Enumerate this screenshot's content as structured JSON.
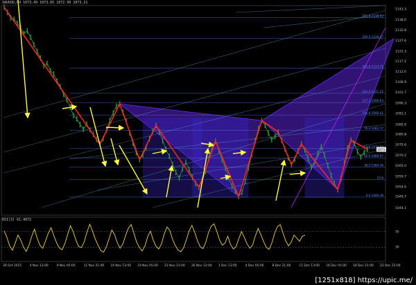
{
  "header": {
    "symbol_line": "XAUUSD,H4  1073.49  1073.65  1072.99  1073.21"
  },
  "rsi_label": "RSI(3) 61.4072",
  "watermark": "[1251x818] https://upic.me/",
  "colors": {
    "background": "#000000",
    "candle": "#2e9c3a",
    "zigzag": "#ff2020",
    "arrow": "#ffff3a",
    "harmonic_fill": "#6a2aff",
    "fib_text": "#5b8fff",
    "trend": "#5fa8d8",
    "rsi": "#f2d33a",
    "axis_text": "#c8c8c8"
  },
  "chart_data": {
    "type": "line",
    "x_ticks": [
      "30 Oct 2015",
      "4 Nov 13:00",
      "9 Nov 05:00",
      "11 Nov 21:00",
      "16 Nov 13:00",
      "19 Nov 05:00",
      "23 Nov 21:00",
      "26 Nov 13:00",
      "1 Dec 13:00",
      "4 Dec 05:00",
      "8 Dec 21:00",
      "11 Dec 13:00",
      "16 Dec 05:00",
      "18 Dec 21:00",
      "23 Dec 13:00"
    ],
    "y_ticks": [
      1044.1,
      1049.7,
      1054.6,
      1059.7,
      1065.0,
      1070.2,
      1075.6,
      1080.8,
      1085.6,
      1091.1,
      1096.3,
      1101.7,
      1106.9,
      1112.0,
      1117.2,
      1122.3,
      1127.6,
      1132.8,
      1138.0,
      1143.3
    ],
    "ylim": [
      1040.4,
      1145.0
    ],
    "price_series": [
      1144.2,
      1141.5,
      1138.8,
      1138.2,
      1136.1,
      1133.8,
      1131.0,
      1132.4,
      1129.2,
      1125.5,
      1122.1,
      1118.7,
      1114.9,
      1116.2,
      1112.5,
      1110.8,
      1107.3,
      1104.5,
      1100.6,
      1097.9,
      1094.2,
      1090.1,
      1088.4,
      1085.6,
      1083.2,
      1085.9,
      1083.0,
      1080.7,
      1078.2,
      1075.8,
      1078.5,
      1082.9,
      1087.6,
      1091.3,
      1094.8,
      1095.9,
      1091.7,
      1087.2,
      1081.5,
      1076.3,
      1071.6,
      1068.1,
      1070.4,
      1074.2,
      1078.6,
      1082.3,
      1085.1,
      1081.8,
      1077.5,
      1073.2,
      1069.8,
      1065.7,
      1061.8,
      1058.9,
      1063.5,
      1066.8,
      1063.0,
      1059.2,
      1056.1,
      1054.2,
      1057.6,
      1062.3,
      1068.9,
      1074.5,
      1077.3,
      1072.6,
      1068.0,
      1063.8,
      1059.0,
      1054.9,
      1052.3,
      1049.7,
      1051.8,
      1057.3,
      1063.9,
      1070.8,
      1077.6,
      1083.5,
      1087.6,
      1085.2,
      1081.3,
      1078.0,
      1079.6,
      1081.9,
      1077.8,
      1073.4,
      1069.0,
      1065.5,
      1068.3,
      1072.5,
      1075.9,
      1073.0,
      1068.6,
      1064.3,
      1066.9,
      1071.2,
      1074.6,
      1070.3,
      1065.1,
      1060.2,
      1056.0,
      1053.1,
      1058.6,
      1066.3,
      1073.8,
      1077.9,
      1076.2,
      1072.1,
      1069.4,
      1071.8,
      1073.2
    ],
    "fib_levels": [
      {
        "label": "0.0  1049.38",
        "value": 1049.4
      },
      {
        "label": "23.6",
        "value": 1058.2
      },
      {
        "label": "38.2  1064.36",
        "value": 1064.4
      },
      {
        "label": "50.0  1068.97",
        "value": 1069.0
      },
      {
        "label": "61.8  1073.58",
        "value": 1073.6
      },
      {
        "label": "76.4  1082.77",
        "value": 1082.8
      },
      {
        "label": "100.0  1090.41",
        "value": 1090.4
      },
      {
        "label": "127.2  1096.63",
        "value": 1096.6
      },
      {
        "label": "141.4  1101.22",
        "value": 1101.2
      },
      {
        "label": "161.8  1113.71",
        "value": 1113.7
      },
      {
        "label": "200.0  1128.47",
        "value": 1128.5
      },
      {
        "label": "261.8  1138.92",
        "value": 1138.9
      }
    ],
    "last_price_label": "1073.2",
    "rsi": {
      "name": "RSI(3)",
      "value": 61.4072,
      "levels": [
        "70",
        "30"
      ],
      "series": [
        72,
        55,
        33,
        22,
        40,
        61,
        48,
        30,
        19,
        35,
        58,
        76,
        52,
        34,
        27,
        46,
        66,
        80,
        59,
        41,
        28,
        23,
        39,
        63,
        85,
        70,
        48,
        31,
        29,
        44,
        68,
        89,
        72,
        51,
        35,
        21,
        17,
        30,
        52,
        74,
        62,
        41,
        27,
        38,
        60,
        79,
        88,
        66,
        43,
        29,
        20,
        33,
        57,
        71,
        48,
        32,
        25,
        39,
        64,
        82,
        73,
        50,
        34,
        22,
        18,
        28,
        49,
        72,
        86,
        69,
        47,
        31,
        26,
        42,
        67,
        84,
        90,
        71,
        49,
        35,
        40,
        58,
        37,
        25,
        31,
        52,
        70,
        55,
        38,
        27,
        35,
        59,
        78,
        62,
        44,
        29,
        24,
        41,
        66,
        83,
        88,
        67,
        46,
        33,
        43,
        61,
        53,
        45,
        58,
        61
      ]
    }
  }
}
